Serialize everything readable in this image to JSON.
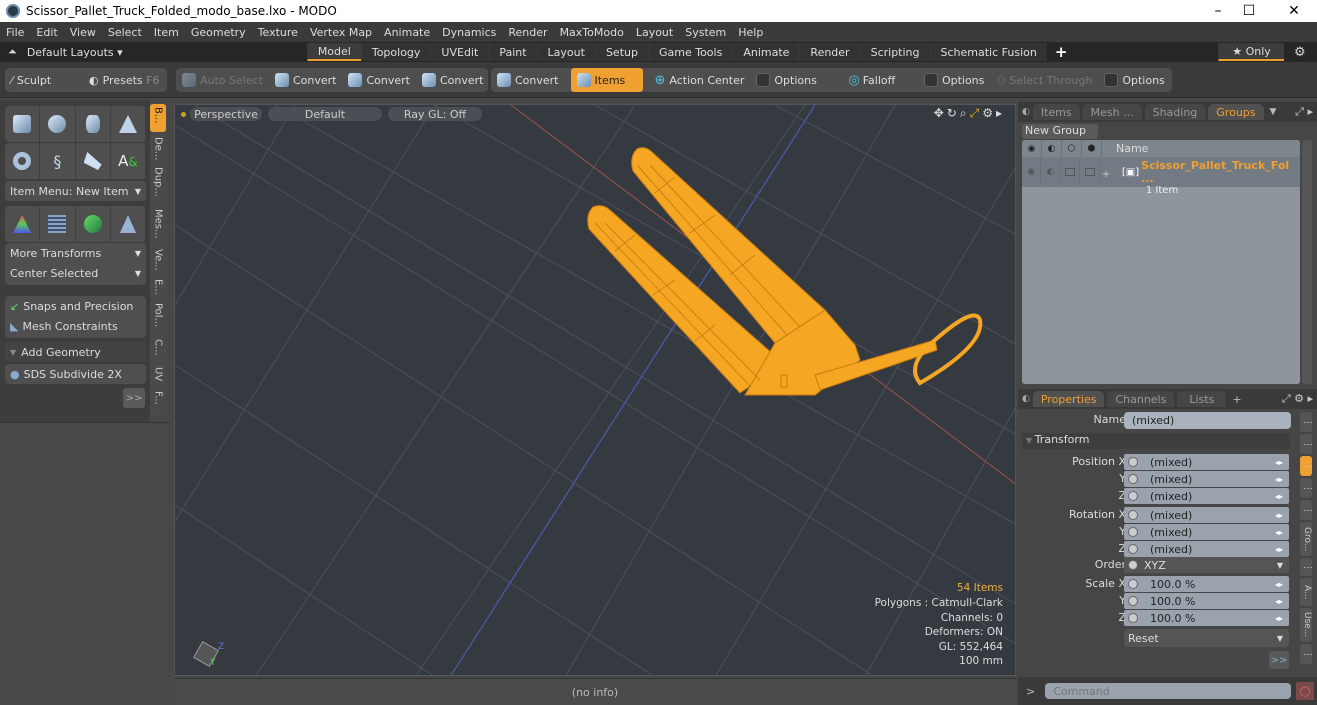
{
  "window": {
    "title": "Scissor_Pallet_Truck_Folded_modo_base.lxo - MODO",
    "minimize": "–",
    "maximize": "☐",
    "close": "✕"
  },
  "menu": [
    "File",
    "Edit",
    "View",
    "Select",
    "Item",
    "Geometry",
    "Texture",
    "Vertex Map",
    "Animate",
    "Dynamics",
    "Render",
    "MaxToModo",
    "Layout",
    "System",
    "Help"
  ],
  "layouts": {
    "default_layouts": "Default Layouts ▾",
    "tabs": [
      "Model",
      "Topology",
      "UVEdit",
      "Paint",
      "Layout",
      "Setup",
      "Game Tools",
      "Animate",
      "Render",
      "Scripting",
      "Schematic Fusion"
    ],
    "active_tab": "Model",
    "add": "+",
    "only": "★ Only",
    "gear": "⚙"
  },
  "toolbar": {
    "sculpt": "Sculpt",
    "presets": "Presets",
    "presets_key": "F6",
    "auto_select": "Auto Select",
    "convert1": "Convert",
    "convert2": "Convert",
    "convert3": "Convert",
    "convert4": "Convert",
    "items": "Items",
    "action_center": "Action Center",
    "options1": "Options",
    "falloff": "Falloff",
    "options2": "Options",
    "select_through": "Select Through",
    "options3": "Options"
  },
  "left_panel": {
    "item_menu": "Item Menu: New Item",
    "more_transforms": "More Transforms",
    "center_selected": "Center Selected",
    "snaps": "Snaps and Precision",
    "mesh_constraints": "Mesh Constraints",
    "add_geometry": "Add Geometry",
    "sds_subdivide": "SDS Subdivide 2X",
    "more": ">>",
    "vtabs": [
      "B...",
      "De...",
      "Dup...",
      "Mes...",
      "Ve...",
      "E...",
      "Pol...",
      "C...",
      "UV",
      "F..."
    ]
  },
  "viewport": {
    "view": "Perspective",
    "shading": "Default",
    "raygl": "Ray GL: Off",
    "info": {
      "items": "54 Items",
      "polygons": "Polygons : Catmull-Clark",
      "channels": "Channels: 0",
      "deformers": "Deformers: ON",
      "gl": "GL: 552,464",
      "scale": "100 mm"
    },
    "status": "(no info)"
  },
  "groups_panel": {
    "tabs": [
      "Items",
      "Mesh ...",
      "Shading",
      "Groups"
    ],
    "active_tab": "Groups",
    "new_group": "New Group",
    "col_name": "Name",
    "group_name": "Scissor_Pallet_Truck_Fol ...",
    "group_count": "1 Item"
  },
  "properties_panel": {
    "tabs": [
      "Properties",
      "Channels",
      "Lists"
    ],
    "active_tab": "Properties",
    "name_label": "Name",
    "name_value": "(mixed)",
    "transform": "Transform",
    "position_label": "Position X",
    "rotation_label": "Rotation X",
    "order_label": "Order",
    "order_value": "XYZ",
    "scale_label": "Scale X",
    "y": "Y",
    "z": "Z",
    "position": [
      "(mixed)",
      "(mixed)",
      "(mixed)"
    ],
    "rotation": [
      "(mixed)",
      "(mixed)",
      "(mixed)"
    ],
    "scale": [
      "100.0 %",
      "100.0 %",
      "100.0 %"
    ],
    "reset": "Reset",
    "more": ">>",
    "vtabs": [
      "Gro...",
      "A...",
      "Use..."
    ]
  },
  "command": {
    "prompt": ">",
    "placeholder": "Command"
  },
  "colors": {
    "accent": "#f0a030",
    "wireframe": "#f5a623",
    "viewport_bg": "#353a40"
  }
}
